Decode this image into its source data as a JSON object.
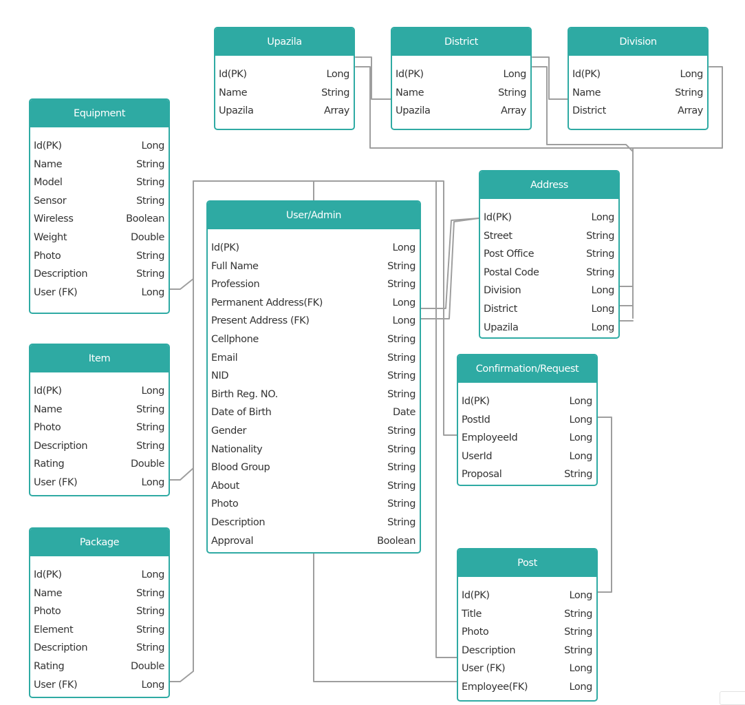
{
  "entities": [
    {
      "id": "upazila",
      "title": "Upazila",
      "fields": [
        {
          "name": "Id(PK)",
          "type": "Long"
        },
        {
          "name": "Name",
          "type": "String"
        },
        {
          "name": "Upazila",
          "type": "Array"
        }
      ]
    },
    {
      "id": "district",
      "title": "District",
      "fields": [
        {
          "name": "Id(PK)",
          "type": "Long"
        },
        {
          "name": "Name",
          "type": "String"
        },
        {
          "name": "Upazila",
          "type": "Array"
        }
      ]
    },
    {
      "id": "division",
      "title": "Division",
      "fields": [
        {
          "name": "Id(PK)",
          "type": "Long"
        },
        {
          "name": "Name",
          "type": "String"
        },
        {
          "name": "District",
          "type": "Array"
        }
      ]
    },
    {
      "id": "equipment",
      "title": "Equipment",
      "fields": [
        {
          "name": "Id(PK)",
          "type": "Long"
        },
        {
          "name": "Name",
          "type": "String"
        },
        {
          "name": "Model",
          "type": "String"
        },
        {
          "name": "Sensor",
          "type": "String"
        },
        {
          "name": "Wireless",
          "type": "Boolean"
        },
        {
          "name": "Weight",
          "type": "Double"
        },
        {
          "name": "Photo",
          "type": "String"
        },
        {
          "name": "Description",
          "type": "String"
        },
        {
          "name": "User (FK)",
          "type": "Long"
        }
      ]
    },
    {
      "id": "user-admin",
      "title": "User/Admin",
      "fields": [
        {
          "name": "Id(PK)",
          "type": "Long"
        },
        {
          "name": "Full Name",
          "type": "String"
        },
        {
          "name": "Profession",
          "type": "String"
        },
        {
          "name": "Permanent Address(FK)",
          "type": "Long"
        },
        {
          "name": "Present Address (FK)",
          "type": "Long"
        },
        {
          "name": "Cellphone",
          "type": "String"
        },
        {
          "name": "Email",
          "type": "String"
        },
        {
          "name": "NID",
          "type": "String"
        },
        {
          "name": "Birth Reg. NO.",
          "type": "String"
        },
        {
          "name": "Date of Birth",
          "type": "Date"
        },
        {
          "name": "Gender",
          "type": "String"
        },
        {
          "name": "Nationality",
          "type": "String"
        },
        {
          "name": "Blood Group",
          "type": "String"
        },
        {
          "name": "About",
          "type": "String"
        },
        {
          "name": "Photo",
          "type": "String"
        },
        {
          "name": "Description",
          "type": "String"
        },
        {
          "name": "Approval",
          "type": "Boolean"
        }
      ]
    },
    {
      "id": "address",
      "title": "Address",
      "fields": [
        {
          "name": "Id(PK)",
          "type": "Long"
        },
        {
          "name": "Street",
          "type": "String"
        },
        {
          "name": "Post Office",
          "type": "String"
        },
        {
          "name": "Postal Code",
          "type": "String"
        },
        {
          "name": "Division",
          "type": "Long"
        },
        {
          "name": "District",
          "type": "Long"
        },
        {
          "name": "Upazila",
          "type": "Long"
        }
      ]
    },
    {
      "id": "item",
      "title": "Item",
      "fields": [
        {
          "name": "Id(PK)",
          "type": "Long"
        },
        {
          "name": "Name",
          "type": "String"
        },
        {
          "name": "Photo",
          "type": "String"
        },
        {
          "name": "Description",
          "type": "String"
        },
        {
          "name": "Rating",
          "type": "Double"
        },
        {
          "name": "User (FK)",
          "type": "Long"
        }
      ]
    },
    {
      "id": "confirmation-request",
      "title": "Confirmation/Request",
      "fields": [
        {
          "name": "Id(PK)",
          "type": "Long"
        },
        {
          "name": "PostId",
          "type": "Long"
        },
        {
          "name": "EmployeeId",
          "type": "Long"
        },
        {
          "name": "UserId",
          "type": "Long"
        },
        {
          "name": "Proposal",
          "type": "String"
        }
      ]
    },
    {
      "id": "package",
      "title": "Package",
      "fields": [
        {
          "name": "Id(PK)",
          "type": "Long"
        },
        {
          "name": "Name",
          "type": "String"
        },
        {
          "name": "Photo",
          "type": "String"
        },
        {
          "name": "Element",
          "type": "String"
        },
        {
          "name": "Description",
          "type": "String"
        },
        {
          "name": "Rating",
          "type": "Double"
        },
        {
          "name": "User (FK)",
          "type": "Long"
        }
      ]
    },
    {
      "id": "post",
      "title": "Post",
      "fields": [
        {
          "name": "Id(PK)",
          "type": "Long"
        },
        {
          "name": "Title",
          "type": "String"
        },
        {
          "name": "Photo",
          "type": "String"
        },
        {
          "name": "Description",
          "type": "String"
        },
        {
          "name": "User (FK)",
          "type": "Long"
        },
        {
          "name": "Employee(FK)",
          "type": "Long"
        }
      ]
    }
  ],
  "colors": {
    "header": "#2eaaa3",
    "border": "#2eaaa3",
    "connector": "#9e9e9e"
  }
}
